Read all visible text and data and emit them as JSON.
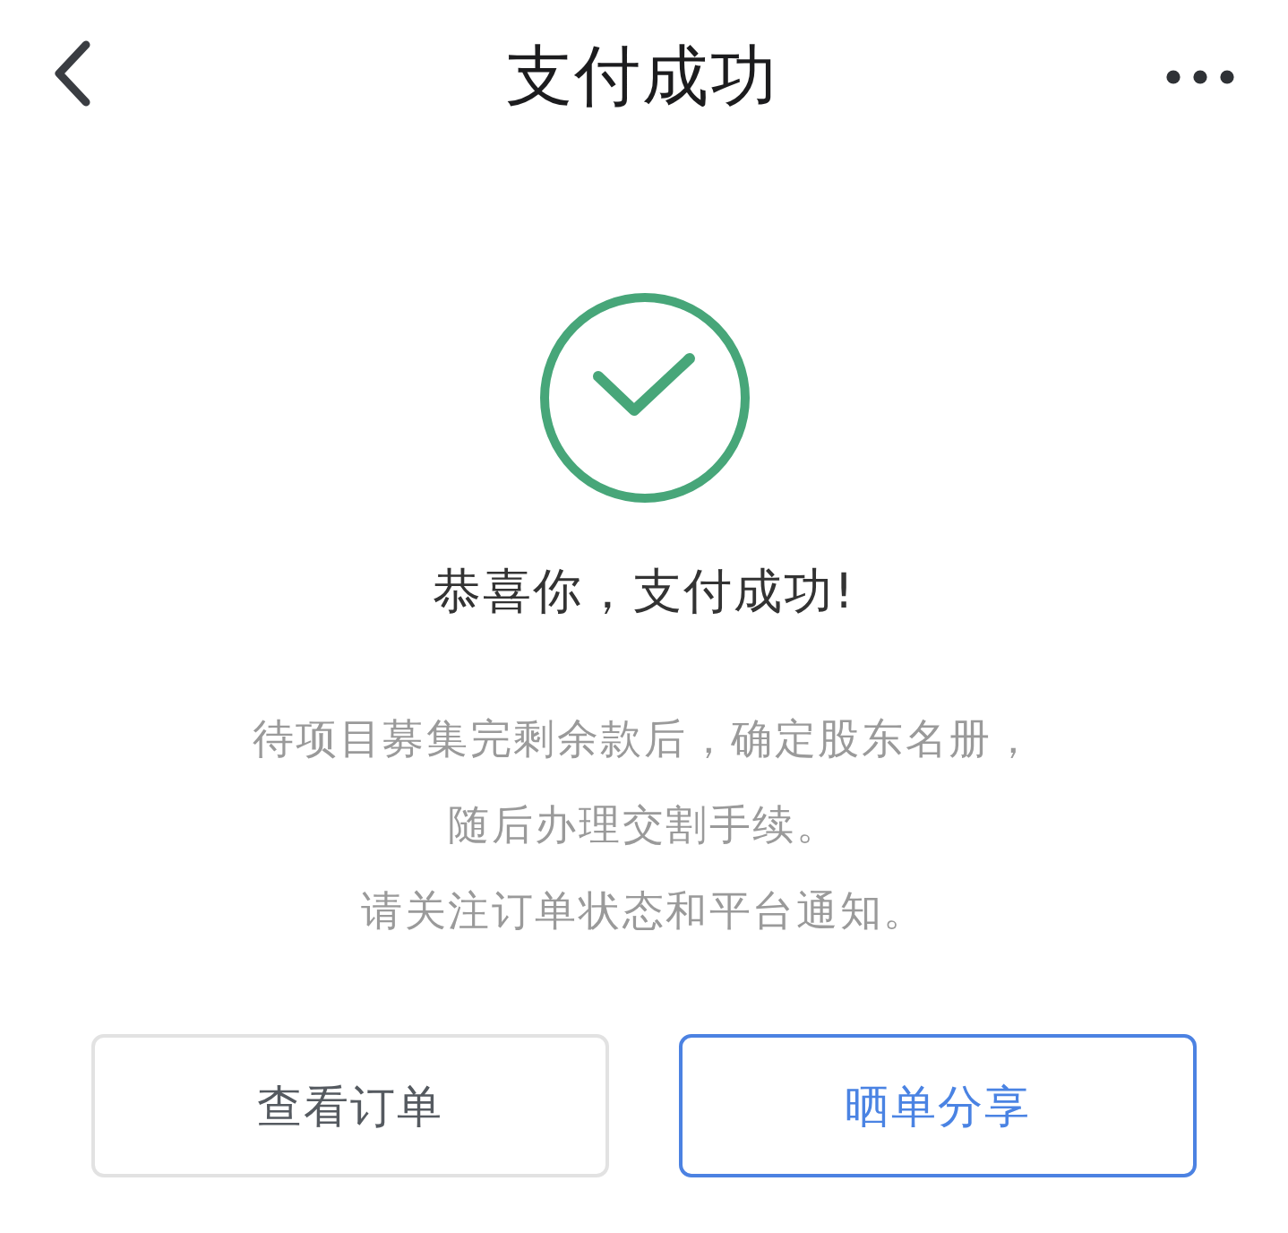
{
  "nav_bar": {
    "title": "支付成功"
  },
  "result": {
    "heading": "恭喜你，支付成功!",
    "message_lines": [
      "待项目募集完剩余款后，确定股东名册，",
      "随后办理交割手续。",
      "请关注订单状态和平台通知。"
    ]
  },
  "buttons": [
    {
      "label": "查看订单",
      "kind": "secondary"
    },
    {
      "label": "晒单分享",
      "kind": "primary"
    }
  ]
}
